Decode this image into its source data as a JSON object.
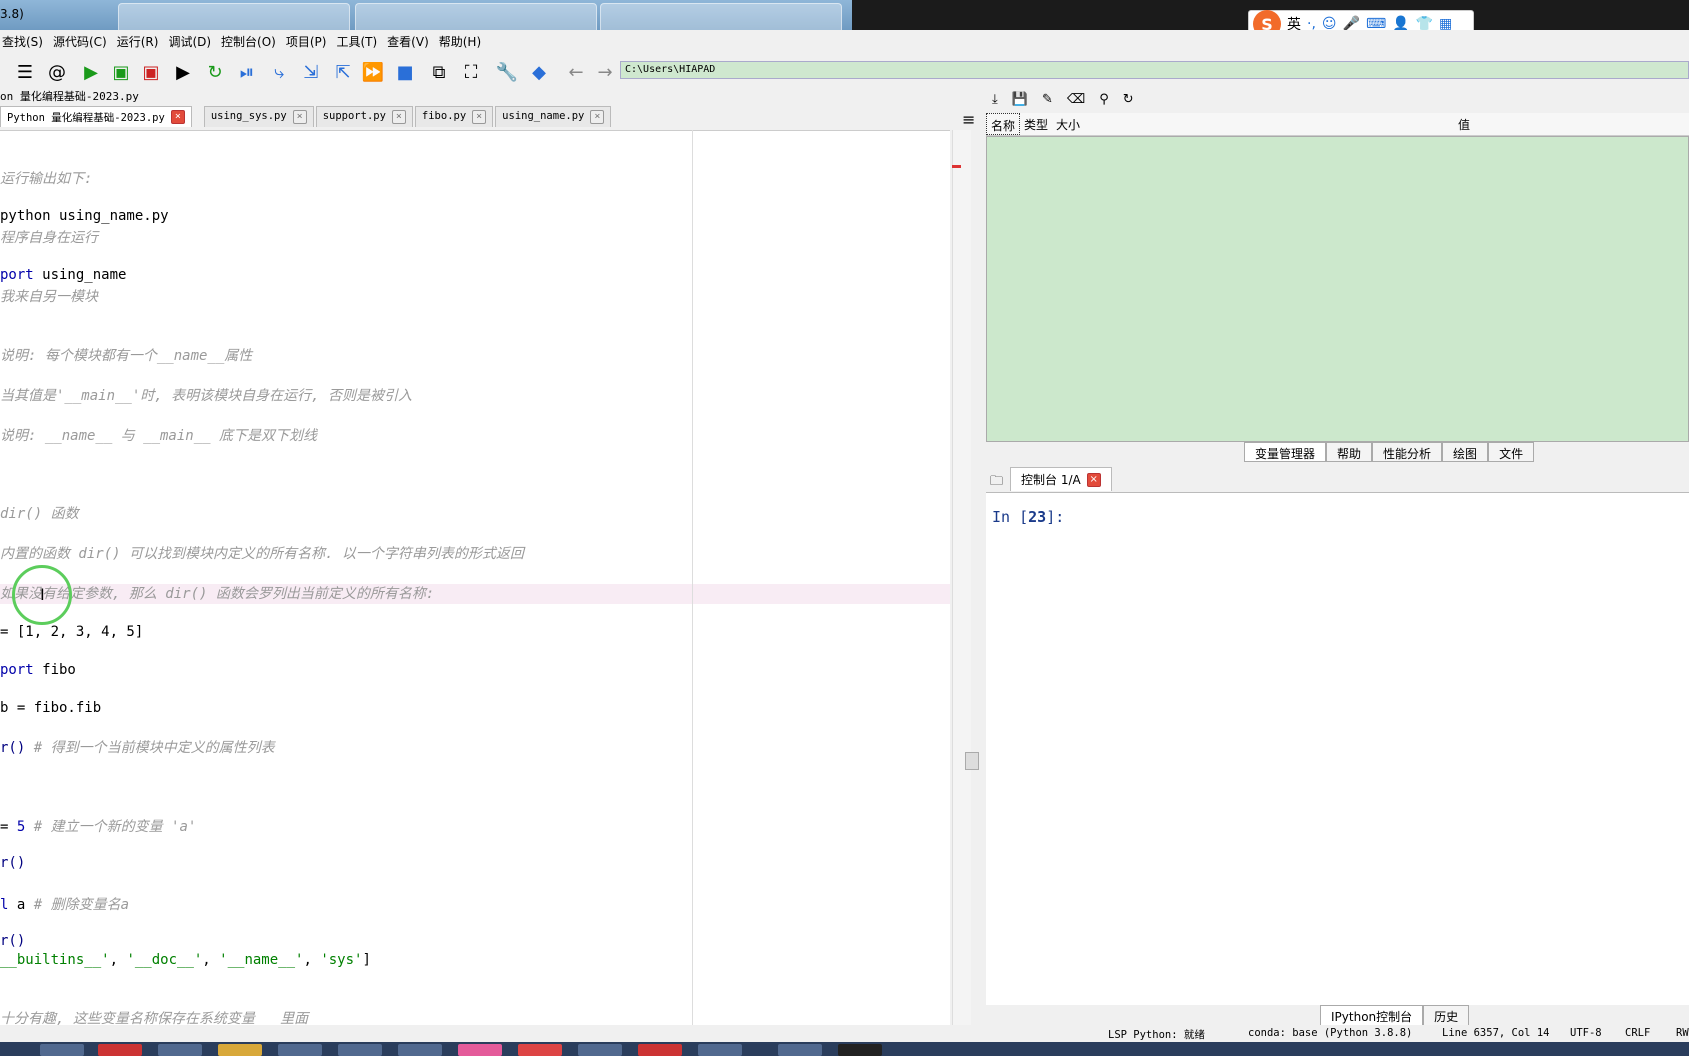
{
  "window": {
    "title_fragment": "3.8)"
  },
  "menu": [
    "查找(S)",
    "源代码(C)",
    "运行(R)",
    "调试(D)",
    "控制台(O)",
    "项目(P)",
    "工具(T)",
    "查看(V)",
    "帮助(H)"
  ],
  "toolbar": {
    "path": "C:\\Users\\HIAPAD"
  },
  "ime": {
    "logo": "S",
    "mode": "英"
  },
  "editor": {
    "file_path": "on 量化编程基础-2023.py",
    "tabs": [
      {
        "label": "Python 量化编程基础-2023.py",
        "active": true
      },
      {
        "label": "using_sys.py"
      },
      {
        "label": "support.py"
      },
      {
        "label": "fibo.py"
      },
      {
        "label": "using_name.py"
      }
    ],
    "lines": [
      {
        "text": "运行输出如下:"
      },
      {
        "text": "python using_name.py"
      },
      {
        "text": "程序自身在运行"
      },
      {
        "a": "port",
        "b": " using_name"
      },
      {
        "text": "我来自另一模块"
      },
      {
        "text": "说明: 每个模块都有一个__name__属性"
      },
      {
        "text": "当其值是'__main__'时, 表明该模块自身在运行, 否则是被引入"
      },
      {
        "text": "说明: __name__ 与 __main__ 底下是双下划线"
      },
      {
        "text": "dir() 函数"
      },
      {
        "text": "内置的函数 dir() 可以找到模块内定义的所有名称. 以一个字符串列表的形式返回"
      },
      {
        "text": "如果没有给定参数, 那么 dir() 函数会罗列出当前定义的所有名称:"
      },
      {
        "text": "= [1, 2, 3, 4, 5]"
      },
      {
        "a": "port",
        "b": " fibo"
      },
      {
        "text": "b = fibo.fib"
      },
      {
        "a": "r()",
        "b": " # 得到一个当前模块中定义的属性列表"
      },
      {
        "a": "= ",
        "b": "5",
        "c": " # 建立一个新的变量 'a'"
      },
      {
        "text": "r()"
      },
      {
        "a": "l",
        "b": " a",
        "c": " # 删除变量名a"
      },
      {
        "text": "r()"
      },
      {
        "a": "__builtins__'",
        "b": ", ",
        "c": "'__doc__'",
        "d": ", ",
        "e": "'__name__'",
        "f": ", ",
        "g": "'sys'",
        "h": "]"
      },
      {
        "text": "十分有趣, 这些变量名称保存在系统变量   里面"
      }
    ]
  },
  "variable_explorer": {
    "columns": [
      "名称",
      "类型",
      "大小",
      "值"
    ]
  },
  "panel_tabs": [
    "变量管理器",
    "帮助",
    "性能分析",
    "绘图",
    "文件"
  ],
  "console": {
    "tab_label": "控制台 1/A",
    "prompt_prefix": "In [",
    "prompt_number": "23",
    "prompt_suffix": "]:"
  },
  "bottom_tabs": [
    "IPython控制台",
    "历史"
  ],
  "status": {
    "lsp": "LSP Python: 就绪",
    "conda": "conda: base (Python 3.8.8)",
    "position": "Line 6357, Col 14",
    "encoding": "UTF-8",
    "eol": "CRLF",
    "perm": "RW"
  }
}
